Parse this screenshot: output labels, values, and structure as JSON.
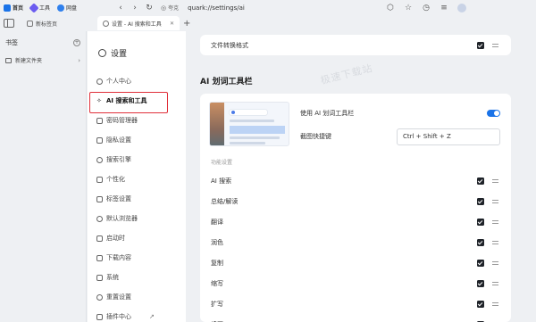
{
  "topbar": {
    "apps": [
      {
        "label": "首页",
        "icon": "home-icon",
        "color": "#1a73e8"
      },
      {
        "label": "工具",
        "icon": "tools-icon",
        "color": "#6b5cf0"
      },
      {
        "label": "网盘",
        "icon": "cloud-drive-icon",
        "color": "#2f80ed"
      }
    ],
    "safe_label": "夸克",
    "url": "quark://settings/ai"
  },
  "tabs": [
    {
      "label": "新标签页"
    },
    {
      "label": "设置 - AI 搜索和工具"
    }
  ],
  "bookmarks": {
    "title": "书签",
    "folder": "新建文件夹"
  },
  "settings": {
    "title": "设置",
    "items": [
      {
        "label": "个人中心"
      },
      {
        "label": "AI 搜索和工具"
      },
      {
        "label": "密码管理器"
      },
      {
        "label": "隐私设置"
      },
      {
        "label": "搜索引擎"
      },
      {
        "label": "个性化"
      },
      {
        "label": "标签设置"
      },
      {
        "label": "默认浏览器"
      },
      {
        "label": "启动时"
      },
      {
        "label": "下载内容"
      },
      {
        "label": "系统"
      },
      {
        "label": "重置设置"
      },
      {
        "label": "插件中心"
      }
    ]
  },
  "main": {
    "top_row": "文件转换格式",
    "section_title": "AI 划词工具栏",
    "watermark": "极速下载站",
    "toolbar": {
      "enable_label": "使用 AI 划词工具栏",
      "enabled": true,
      "shortcut_label": "截图快捷键",
      "shortcut_value": "Ctrl + Shift + Z"
    },
    "feature_header": "功能设置",
    "features": [
      {
        "label": "AI 搜索",
        "checked": true
      },
      {
        "label": "总结/解读",
        "checked": true
      },
      {
        "label": "翻译",
        "checked": true
      },
      {
        "label": "润色",
        "checked": true
      },
      {
        "label": "复制",
        "checked": true
      },
      {
        "label": "缩写",
        "checked": true
      },
      {
        "label": "扩写",
        "checked": true
      },
      {
        "label": "续写",
        "checked": true
      }
    ]
  }
}
